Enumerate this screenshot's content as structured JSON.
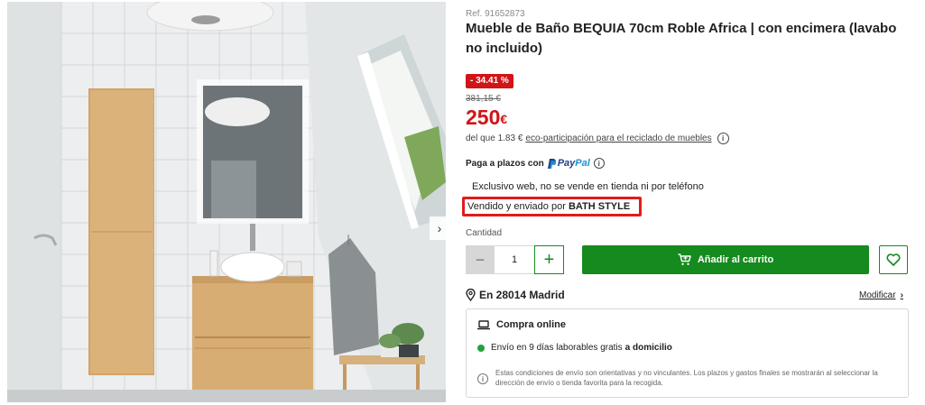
{
  "gallery": {
    "image_alt": "Mueble de baño con encimera y lavabo sobre encimera, espejo retroiluminado y columna de madera",
    "next_icon": "chevron-right-icon"
  },
  "product": {
    "ref": "Ref. 91652873",
    "title": "Mueble de Baño BEQUIA 70cm Roble Africa | con encimera (lavabo no incluido)",
    "discount": "- 34.41 %",
    "old_price": "381,15 €",
    "price_integer": "250",
    "price_currency": "€",
    "eco_prefix": "del que 1.83 €",
    "eco_link": "eco-participación para el reciclado de muebles",
    "installments_label": "Paga a plazos con",
    "paypal_pay": "Pay",
    "paypal_pal": "Pal",
    "exclusive_text": "Exclusivo web, no se vende en tienda ni por teléfono",
    "seller_prefix": "Vendido y enviado por",
    "seller_name": "BATH STYLE"
  },
  "purchase": {
    "quantity_label": "Cantidad",
    "quantity_value": "1",
    "minus_label": "−",
    "plus_label": "+",
    "add_to_cart_label": "Añadir al carrito",
    "cart_icon": "cart-icon",
    "wishlist_icon": "heart-icon"
  },
  "location": {
    "label": "En 28014 Madrid",
    "modify_label": "Modificar",
    "modify_chevron": "›"
  },
  "shipping": {
    "heading": "Compra online",
    "delivery_prefix": "Envío en 9 días laborables gratis",
    "delivery_strong": "a domicilio",
    "note": "Estas condiciones de envío son orientativas y no vinculantes. Los plazos y gastos finales se mostrarán al seleccionar la dirección de envío o tienda favorita para la recogida."
  },
  "colors": {
    "brand_green": "#158a1e",
    "price_red": "#d01417",
    "highlight_red": "#e21b1b",
    "status_green": "#21a33a"
  }
}
